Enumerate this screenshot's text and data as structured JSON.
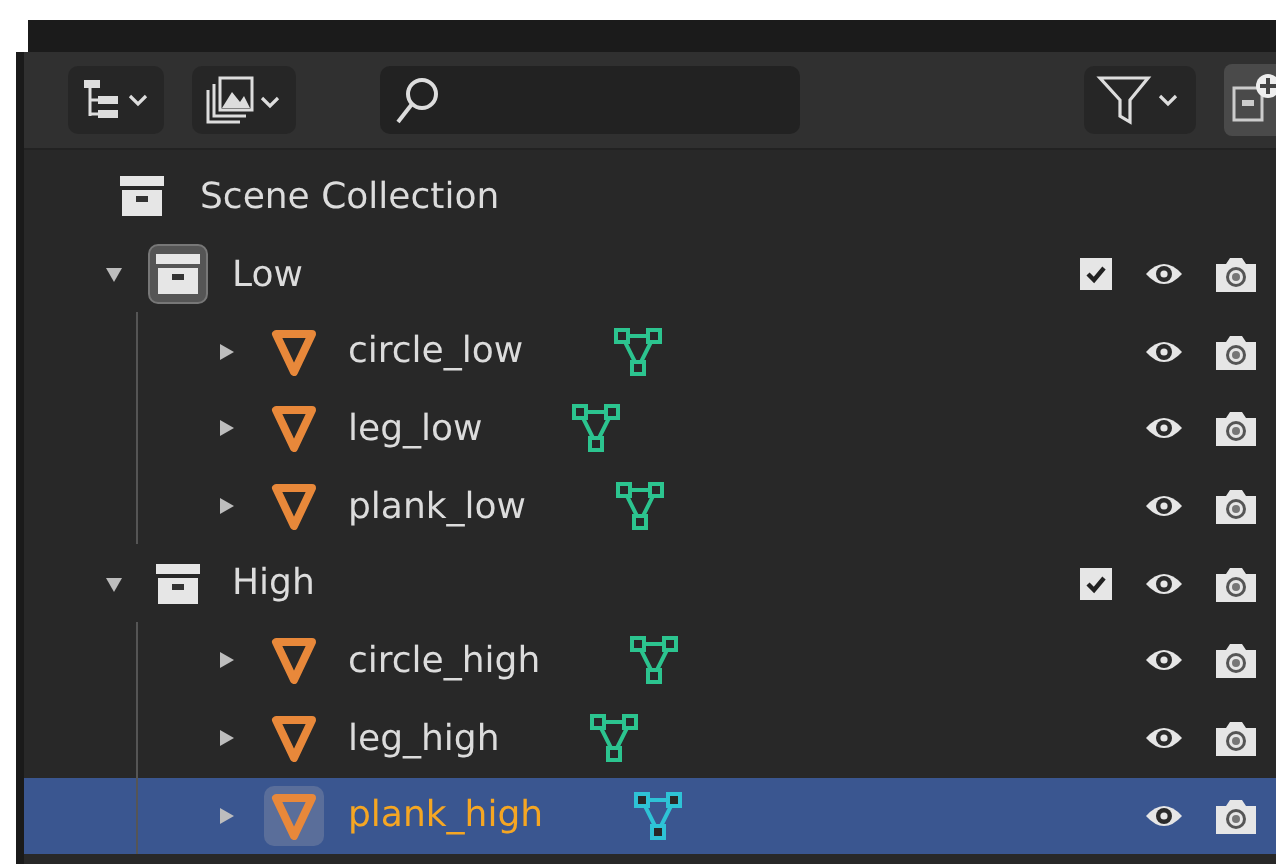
{
  "scene_collection": {
    "label": "Scene Collection"
  },
  "collections": [
    {
      "label": "Low",
      "expanded": true,
      "active": true,
      "checked": true,
      "children": [
        {
          "label": "circle_low",
          "expanded": false,
          "selected": false
        },
        {
          "label": "leg_low",
          "expanded": false,
          "selected": false
        },
        {
          "label": "plank_low",
          "expanded": false,
          "selected": false
        }
      ]
    },
    {
      "label": "High",
      "expanded": true,
      "active": false,
      "checked": true,
      "children": [
        {
          "label": "circle_high",
          "expanded": false,
          "selected": false
        },
        {
          "label": "leg_high",
          "expanded": false,
          "selected": false
        },
        {
          "label": "plank_high",
          "expanded": false,
          "selected": true
        }
      ]
    }
  ]
}
